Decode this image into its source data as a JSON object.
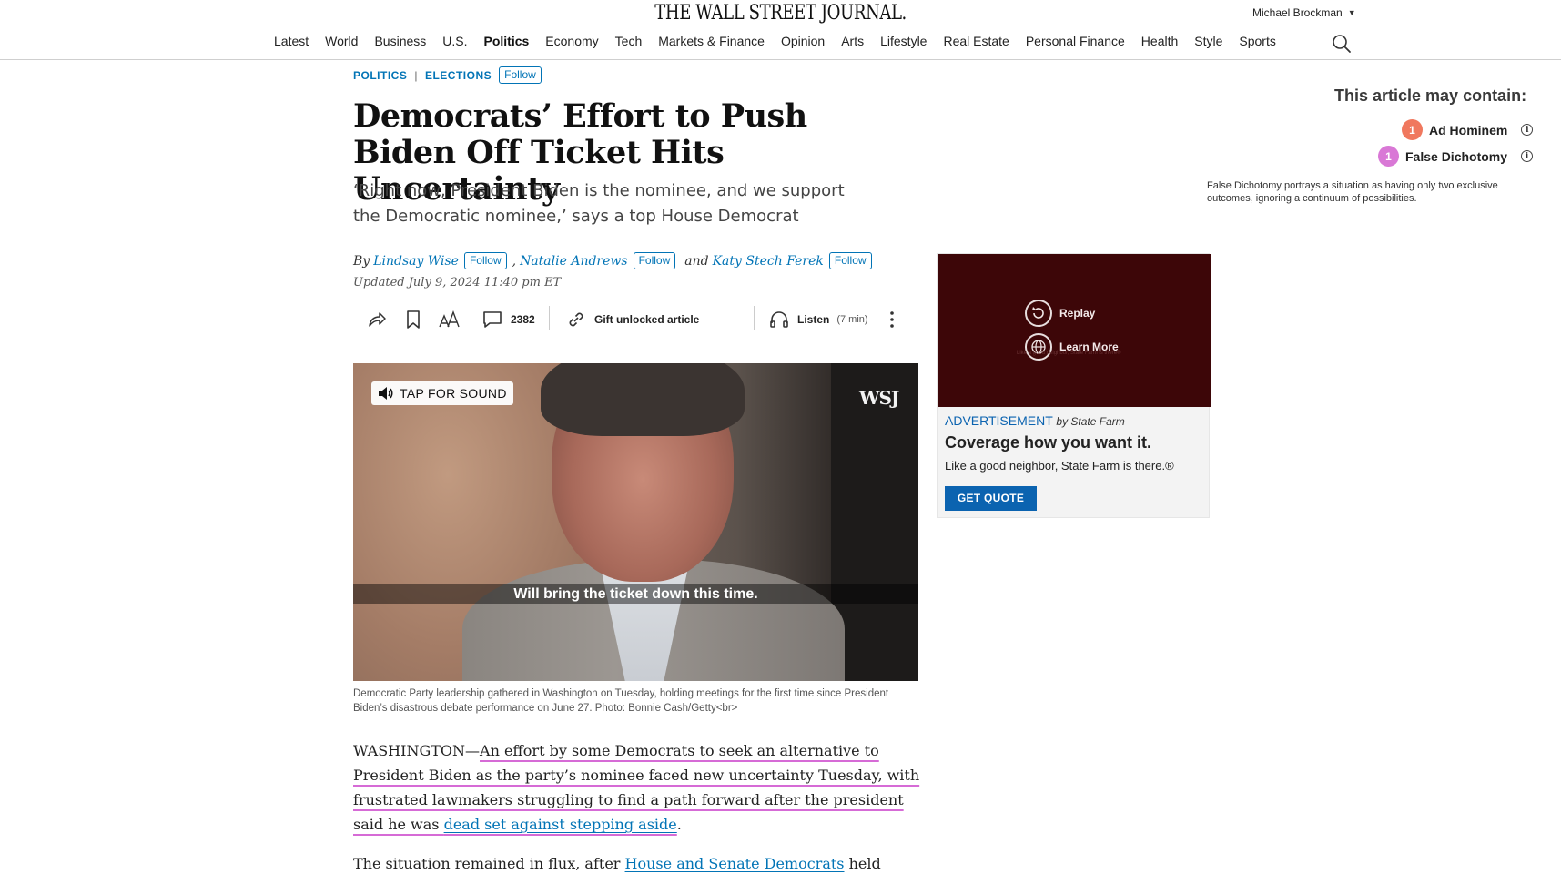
{
  "header": {
    "logo": "THE WALL STREET JOURNAL.",
    "user_name": "Michael Brockman",
    "nav": [
      "Latest",
      "World",
      "Business",
      "U.S.",
      "Politics",
      "Economy",
      "Tech",
      "Markets & Finance",
      "Opinion",
      "Arts",
      "Lifestyle",
      "Real Estate",
      "Personal Finance",
      "Health",
      "Style",
      "Sports"
    ],
    "active_nav": "Politics"
  },
  "article": {
    "flag_primary": "POLITICS",
    "flag_separator": "|",
    "flag_secondary": "ELECTIONS",
    "follow_label": "Follow",
    "headline": "Democrats’ Effort to Push Biden Off Ticket Hits Uncertainty",
    "dek": "‘Right now, President Biden is the nominee, and we support the Democratic nominee,’ says a top House Democrat",
    "byline": {
      "by": "By",
      "author1": "Lindsay Wise",
      "comma": ",",
      "author2": "Natalie Andrews",
      "and": "and",
      "author3": "Katy Stech Ferek"
    },
    "updated": "Updated July 9, 2024 11:40 pm ET",
    "toolbar": {
      "comments_count": "2382",
      "gift_label": "Gift unlocked article",
      "listen_label": "Listen",
      "listen_duration": "(7 min)"
    },
    "video": {
      "sound_label": "TAP FOR SOUND",
      "watermark": "WSJ",
      "subtitle": "Will bring the ticket down this time."
    },
    "caption": "Democratic Party leadership gathered in Washington on Tuesday, holding meetings for the first time since President Biden’s disastrous debate performance on June 27. Photo: Bonnie Cash/Getty<br>",
    "p1": {
      "dateline": "WASHINGTON—",
      "highlighted": "An effort by some Democrats to seek an alternative to President Biden as the party’s nominee faced new uncertainty Tuesday, with frustrated lawmakers struggling to find a path forward after the president said he was ",
      "link": "dead set against stepping aside",
      "end": "."
    },
    "p2": {
      "start": "The situation remained in flux, after ",
      "link": "House and Senate Democrats",
      "end": " held"
    }
  },
  "ad": {
    "replay_label": "Replay",
    "learn_more_label": "Learn More",
    "ghost_text": "Like a good neighbor, State Farm is there®",
    "label": "ADVERTISEMENT",
    "sponsor": "by State Farm",
    "title": "Coverage how you want it.",
    "subtitle": "Like a good neighbor, State Farm is there.®",
    "cta": "GET QUOTE",
    "colors": {
      "background": "#3d0608",
      "cta": "#0b63b0"
    }
  },
  "fallacy_panel": {
    "title": "This article may contain:",
    "items": [
      {
        "count": "1",
        "name": "Ad Hominem",
        "color": "#f0785e"
      },
      {
        "count": "1",
        "name": "False Dichotomy",
        "color": "#d978d6"
      }
    ],
    "description": "False Dichotomy portrays a situation as having only two exclusive outcomes, ignoring a continuum of possibilities."
  },
  "colors": {
    "link": "#0274b6",
    "highlight_underline": "#d66bd6"
  }
}
